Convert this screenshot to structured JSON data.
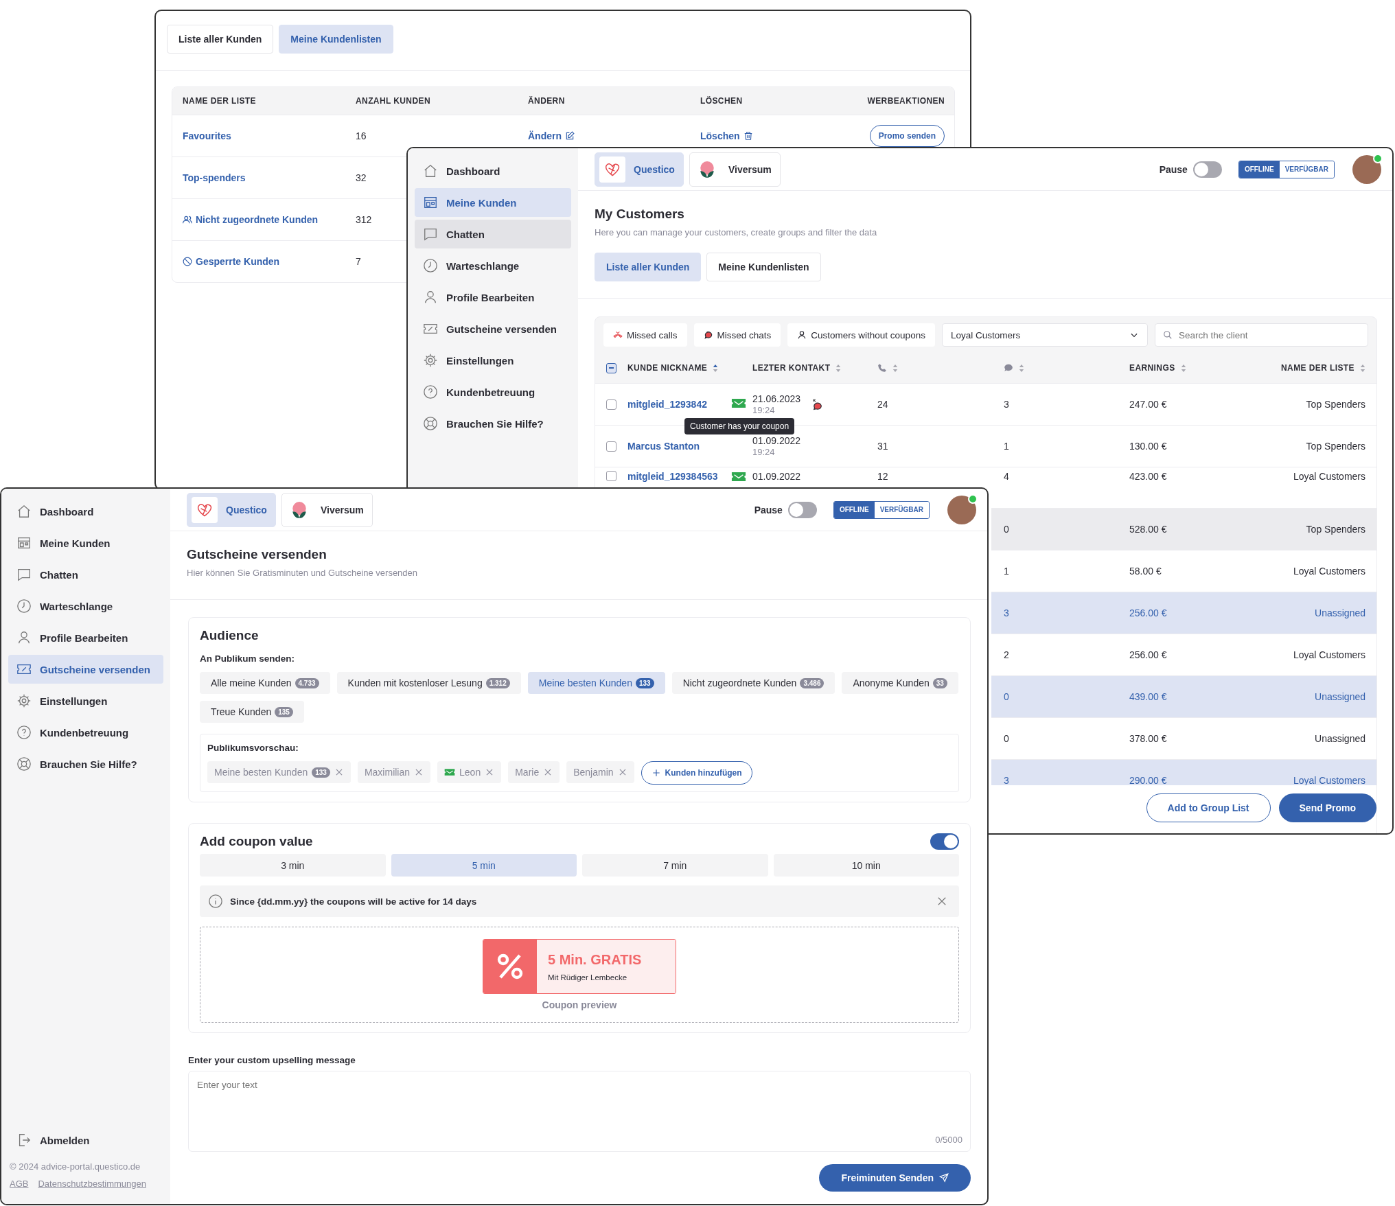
{
  "list_window": {
    "tabs": [
      {
        "label": "Liste aller Kunden",
        "selected": false
      },
      {
        "label": "Meine Kundenlisten",
        "selected": true
      }
    ],
    "columns": [
      "NAME DER LISTE",
      "ANZAHL KUNDEN",
      "ÄNDERN",
      "LÖSCHEN",
      "WERBEAKTIONEN"
    ],
    "rows": [
      {
        "kind": "plain",
        "name": "Favourites",
        "count": "16",
        "edit": "Ändern",
        "delete": "Löschen",
        "promo": "Promo senden"
      },
      {
        "kind": "plain",
        "name": "Top-spenders",
        "count": "32"
      },
      {
        "kind": "unassigned",
        "name": "Nicht zugeordnete Kunden",
        "count": "312"
      },
      {
        "kind": "blocked",
        "name": "Gesperrte Kunden",
        "count": "7"
      }
    ]
  },
  "customers_window": {
    "sidebar": {
      "items": [
        {
          "label": "Dashboard",
          "selected": false,
          "hovered": false
        },
        {
          "label": "Meine Kunden",
          "selected": true,
          "hovered": false
        },
        {
          "label": "Chatten",
          "selected": false,
          "hovered": true
        },
        {
          "label": "Warteschlange",
          "selected": false,
          "hovered": false
        },
        {
          "label": "Profile Bearbeiten",
          "selected": false,
          "hovered": false
        },
        {
          "label": "Gutscheine versenden",
          "selected": false,
          "hovered": false
        },
        {
          "label": "Einstellungen",
          "selected": false,
          "hovered": false
        },
        {
          "label": "Kundenbetreuung",
          "selected": false,
          "hovered": false
        },
        {
          "label": "Brauchen Sie Hilfe?",
          "selected": false,
          "hovered": false
        }
      ]
    },
    "topbar": {
      "brands": [
        {
          "name": "Questico",
          "kind": "heart",
          "selected": true
        },
        {
          "name": "Viversum",
          "kind": "leaf",
          "selected": false
        }
      ],
      "pause": {
        "label": "Pause",
        "on": false
      },
      "status": [
        {
          "label": "OFFLINE",
          "selected": true
        },
        {
          "label": "VERFÜGBAR",
          "selected": false
        }
      ],
      "avatar": {
        "online": true
      }
    },
    "title": "My Customers",
    "subtitle": "Here you can manage your customers, create groups and filter the data",
    "tabs": [
      {
        "label": "Liste aller Kunden",
        "selected": true
      },
      {
        "label": "Meine Kundenlisten",
        "selected": false
      }
    ],
    "filters": [
      {
        "label": "Missed calls",
        "kind": "missed-call"
      },
      {
        "label": "Missed chats",
        "kind": "missed-chat"
      },
      {
        "label": "Customers without coupons",
        "kind": "person"
      }
    ],
    "list_select": {
      "value": "Loyal Customers"
    },
    "search": {
      "placeholder": "Search the client"
    },
    "table": {
      "select_all_partial": true,
      "columns": [
        {
          "kind": "text",
          "label": "KUNDE NICKNAME",
          "sorted": true
        },
        {
          "kind": "text",
          "label": "LEZTER KONTAKT",
          "sorted": false
        },
        {
          "kind": "phone",
          "sorted": false
        },
        {
          "kind": "chat",
          "sorted": false
        },
        {
          "kind": "text",
          "label": "EARNINGS",
          "sorted": false
        },
        {
          "kind": "text",
          "label": "NAME DER LISTE",
          "sorted": false
        }
      ],
      "rows": [
        {
          "name": "mitgleid_1293842",
          "has_coupon": true,
          "date": "21.06.2023",
          "time": "19:24",
          "missed_chat": true,
          "calls": "24",
          "chats": "3",
          "earnings": "247.00 €",
          "list": "Top Spenders",
          "selected": false,
          "hovered": false
        },
        {
          "name": "Marcus Stanton",
          "has_coupon": false,
          "date": "01.09.2022",
          "time": "19:24",
          "missed_chat": false,
          "calls": "31",
          "chats": "1",
          "earnings": "130.00 €",
          "list": "Top Spenders",
          "selected": false,
          "hovered": false
        },
        {
          "name": "mitgleid_129384563",
          "has_coupon": true,
          "date": "01.09.2022",
          "missed_chat": false,
          "calls": "12",
          "chats": "4",
          "earnings": "423.00 €",
          "list": "Loyal Customers",
          "selected": false,
          "hovered": false
        },
        {
          "chats": "0",
          "earnings": "528.00 €",
          "list": "Top Spenders",
          "selected": false,
          "hovered": true
        },
        {
          "chats": "1",
          "earnings": "58.00 €",
          "list": "Loyal Customers",
          "selected": false,
          "hovered": false
        },
        {
          "chats": "3",
          "earnings": "256.00 €",
          "list": "Unassigned",
          "selected": true,
          "hovered": false
        },
        {
          "chats": "2",
          "earnings": "256.00 €",
          "list": "Loyal Customers",
          "selected": false,
          "hovered": false
        },
        {
          "chats": "0",
          "earnings": "439.00 €",
          "list": "Unassigned",
          "selected": true,
          "hovered": false
        },
        {
          "chats": "0",
          "earnings": "378.00 €",
          "list": "Unassigned",
          "selected": false,
          "hovered": false
        },
        {
          "chats": "3",
          "earnings": "290.00 €",
          "list": "Loyal Customers",
          "selected": true,
          "hovered": false
        }
      ]
    },
    "tooltip": "Customer has your coupon",
    "buttons": [
      {
        "label": "Add to Group List",
        "kind": "outline"
      },
      {
        "label": "Send Promo",
        "kind": "primary"
      }
    ]
  },
  "coupon_window": {
    "sidebar": {
      "items": [
        {
          "label": "Dashboard",
          "selected": false
        },
        {
          "label": "Meine Kunden",
          "selected": false
        },
        {
          "label": "Chatten",
          "selected": false
        },
        {
          "label": "Warteschlange",
          "selected": false
        },
        {
          "label": "Profile Bearbeiten",
          "selected": false
        },
        {
          "label": "Gutscheine versenden",
          "selected": true
        },
        {
          "label": "Einstellungen",
          "selected": false
        },
        {
          "label": "Kundenbetreuung",
          "selected": false
        },
        {
          "label": "Brauchen Sie Hilfe?",
          "selected": false
        }
      ],
      "logout": "Abmelden",
      "copyright": "© 2024 advice-portal.questico.de",
      "links": [
        "AGB",
        "Datenschutzbestimmungen"
      ]
    },
    "topbar": {
      "brands": [
        {
          "name": "Questico",
          "kind": "heart",
          "selected": true
        },
        {
          "name": "Viversum",
          "kind": "leaf",
          "selected": false
        }
      ],
      "pause": {
        "label": "Pause",
        "on": false
      },
      "status": [
        {
          "label": "OFFLINE",
          "selected": true
        },
        {
          "label": "VERFÜGBAR",
          "selected": false
        }
      ],
      "avatar": {
        "online": true
      }
    },
    "title": "Gutscheine versenden",
    "subtitle": "Hier können Sie Gratisminuten und Gutscheine versenden",
    "audience": {
      "title": "Audience",
      "label": "An Publikum senden:",
      "chips": [
        {
          "label": "Alle meine Kunden",
          "count": "4.733",
          "selected": false
        },
        {
          "label": "Kunden mit kostenloser Lesung",
          "count": "1.312",
          "selected": false
        },
        {
          "label": "Meine besten Kunden",
          "count": "133",
          "selected": true
        },
        {
          "label": "Nicht zugeordnete Kunden",
          "count": "3.486",
          "selected": false
        },
        {
          "label": "Anonyme Kunden",
          "count": "33",
          "selected": false
        },
        {
          "label": "Treue Kunden",
          "count": "135",
          "selected": false
        }
      ],
      "preview": {
        "label": "Publikumsvorschau:",
        "chips": [
          {
            "label": "Meine besten Kunden",
            "count": "133",
            "has_coupon": false
          },
          {
            "label": "Maximilian",
            "has_coupon": false
          },
          {
            "label": "Leon",
            "has_coupon": true
          },
          {
            "label": "Marie",
            "has_coupon": false
          },
          {
            "label": "Benjamin",
            "has_coupon": false
          }
        ],
        "add": "Kunden hinzufügen"
      }
    },
    "coupon": {
      "title": "Add coupon value",
      "on": true,
      "options": [
        {
          "label": "3 min",
          "selected": false
        },
        {
          "label": "5 min",
          "selected": true
        },
        {
          "label": "7 min",
          "selected": false
        },
        {
          "label": "10 min",
          "selected": false
        }
      ],
      "info": "Since {dd.mm.yy} the coupons will be active for 14 days",
      "ticket_title": "5 Min. GRATIS",
      "ticket_subtitle": "Mit Rüdiger Lembecke",
      "caption": "Coupon preview"
    },
    "message": {
      "label": "Enter your custom upselling message",
      "placeholder": "Enter your text",
      "counter": "0/5000"
    },
    "send": "Freiminuten Senden"
  }
}
